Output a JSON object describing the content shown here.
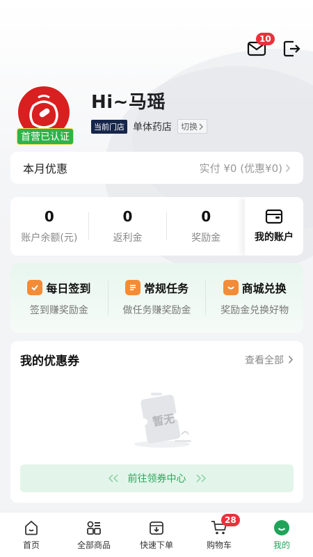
{
  "header": {
    "mail_badge": "10"
  },
  "profile": {
    "greeting": "Hi~马瑶",
    "cert_label": "首营已认证",
    "store_tag": "当前门店",
    "store_name": "单体药店",
    "switch_label": "切换"
  },
  "monthly": {
    "label": "本月优惠",
    "value": "实付 ¥0 (优惠¥0)"
  },
  "account": {
    "items": [
      {
        "value": "0",
        "label": "账户余额(元)"
      },
      {
        "value": "0",
        "label": "返利金"
      },
      {
        "value": "0",
        "label": "奖励金"
      }
    ],
    "my_account_label": "我的账户"
  },
  "tasks": [
    {
      "title": "每日签到",
      "sub": "签到赚奖励金",
      "icon": "check-shield-icon",
      "color": "#f28c38"
    },
    {
      "title": "常规任务",
      "sub": "做任务赚奖励金",
      "icon": "document-icon",
      "color": "#f28c38"
    },
    {
      "title": "商城兑换",
      "sub": "奖励金兑换好物",
      "icon": "shop-bag-icon",
      "color": "#f28c38"
    }
  ],
  "coupons": {
    "title": "我的优惠券",
    "more_label": "查看全部",
    "empty_text": "暂无",
    "cta_label": "前往领券中心"
  },
  "tabbar": {
    "items": [
      {
        "label": "首页",
        "icon": "home-icon"
      },
      {
        "label": "全部商品",
        "icon": "grid-icon"
      },
      {
        "label": "快速下单",
        "icon": "quick-order-icon"
      },
      {
        "label": "购物车",
        "icon": "cart-icon"
      },
      {
        "label": "我的",
        "icon": "profile-icon"
      }
    ],
    "cart_badge": "28",
    "active_color": "#1fa45a"
  }
}
